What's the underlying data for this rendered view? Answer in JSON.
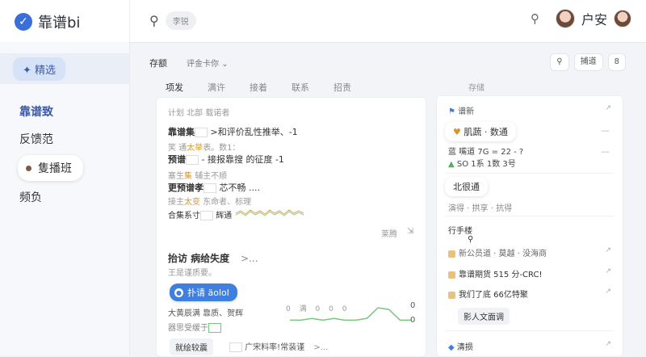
{
  "header": {
    "brand_name": "靠谱bi",
    "search_placeholder": "李锐",
    "username": "户安"
  },
  "sidebar": {
    "chip_label": "精选",
    "items": [
      "靠谱致",
      "反馈范",
      "隻播班",
      "频负"
    ],
    "active_index": 0,
    "pill_index": 2
  },
  "filters": {
    "title": "存额",
    "dropdown": "评金卡你",
    "buttons": [
      "捕道",
      "8"
    ]
  },
  "tabs": {
    "items": [
      "项发",
      "满许",
      "接着",
      "联系",
      "招责"
    ],
    "active_index": 0,
    "right_label": "存储"
  },
  "main_card": {
    "header": "计划 北部 载诺者",
    "rows": [
      {
        "label": "靠谱集",
        "text": ">和评价乱性推举、-1"
      },
      {
        "label": "笑 通",
        "highlight": "太举",
        "text": "表。数1："
      },
      {
        "label": "预谱",
        "text": "- 接报靠搜 的征度 -1"
      },
      {
        "label": "塞生",
        "highlight": "集",
        "text": "辅主不顺"
      },
      {
        "label": "更预谱孝",
        "text": "芯不畅 ...."
      },
      {
        "label": "接主",
        "highlight": "太变",
        "text": "东命者、标理"
      },
      {
        "label": "合集系寸",
        "text": "辉通"
      }
    ],
    "more_label": "莱腾",
    "section_title": "抬访 病给失度",
    "section_more": ">...",
    "section_sub": "王是谨质要。",
    "pill_label": "扑请 äolol",
    "lines": [
      "大黄辰满 靠质、贺辉",
      "器思受缓于"
    ],
    "mini_chart": {
      "ticks": [
        "0",
        "满",
        "0",
        "0",
        "0"
      ],
      "values": [
        3,
        3,
        4,
        3,
        4,
        3,
        3,
        4,
        10,
        9,
        3,
        3
      ],
      "right_top": "0",
      "right_bottom": "0",
      "line_color": "#7bc47f"
    },
    "footer_button": "就绘较震",
    "footer_text": "广宋料率!常装谨",
    "footer_more": ">..."
  },
  "right_card": {
    "title": "谱新",
    "chip": "肌蔬 · 数通",
    "stat1": "蓝 嘴道 7G = 22 - ?",
    "stat2": "SO 1系 1数 3号",
    "tag": "北很通",
    "row1": "演得 · 拱享 · 抗得",
    "section2": "行手楼",
    "items": [
      "新公员道 · 莫越 · 没海商",
      "靠谱期货 515 分-CRC!",
      "我们了底 66亿特聚"
    ],
    "button": "影人文面调",
    "footer": "清损",
    "accent": "#e8c27a"
  }
}
